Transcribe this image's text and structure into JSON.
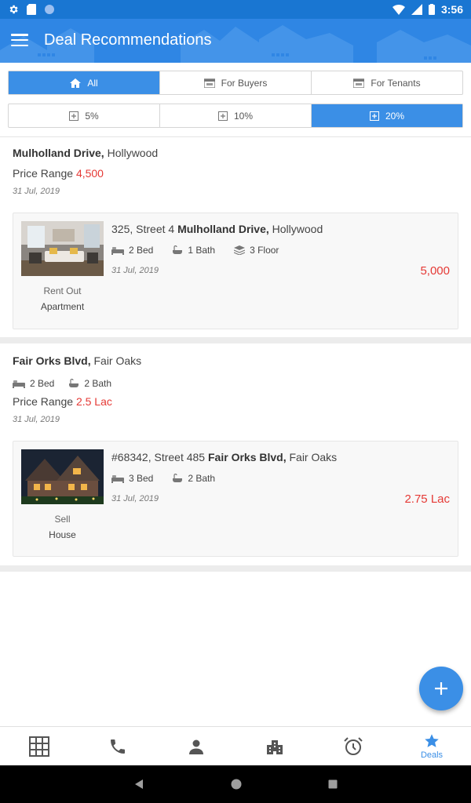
{
  "status_bar": {
    "time": "3:56"
  },
  "app_bar": {
    "title": "Deal Recommendations"
  },
  "filters": {
    "type_options": [
      {
        "label": "All",
        "active": true
      },
      {
        "label": "For Buyers",
        "active": false
      },
      {
        "label": "For Tenants",
        "active": false
      }
    ],
    "percent_options": [
      {
        "label": "5%",
        "active": false
      },
      {
        "label": "10%",
        "active": false
      },
      {
        "label": "20%",
        "active": true
      }
    ]
  },
  "deals": [
    {
      "location_bold": "Mulholland Drive,",
      "location_rest": " Hollywood",
      "price_label": "Price Range ",
      "price_value": "4,500",
      "date": "31 Jul, 2019",
      "card": {
        "address_prefix": "325, Street 4 ",
        "address_bold": "Mulholland Drive,",
        "address_rest": " Hollywood",
        "beds": "2 Bed",
        "baths": "1 Bath",
        "floors": "3 Floor",
        "date": "31 Jul, 2019",
        "price": "5,000",
        "listing_type": "Rent Out",
        "property_type": "Apartment"
      }
    },
    {
      "location_bold": "Fair Orks Blvd,",
      "location_rest": " Fair Oaks",
      "beds": "2 Bed",
      "baths": "2 Bath",
      "price_label": "Price Range ",
      "price_value": "2.5 Lac",
      "date": "31 Jul, 2019",
      "card": {
        "address_prefix": "#68342, Street 485 ",
        "address_bold": "Fair Orks Blvd,",
        "address_rest": " Fair Oaks",
        "beds": "3 Bed",
        "baths": "2 Bath",
        "date": "31 Jul, 2019",
        "price": "2.75 Lac",
        "listing_type": "Sell",
        "property_type": "House"
      }
    }
  ],
  "bottom_nav": {
    "items": [
      "grid-icon",
      "phone-icon",
      "person-icon",
      "building-icon",
      "alarm-icon",
      "star-icon"
    ],
    "deals_label": "Deals"
  },
  "colors": {
    "primary": "#2f86e4",
    "accent": "#3b8fe6",
    "price": "#e53935"
  }
}
